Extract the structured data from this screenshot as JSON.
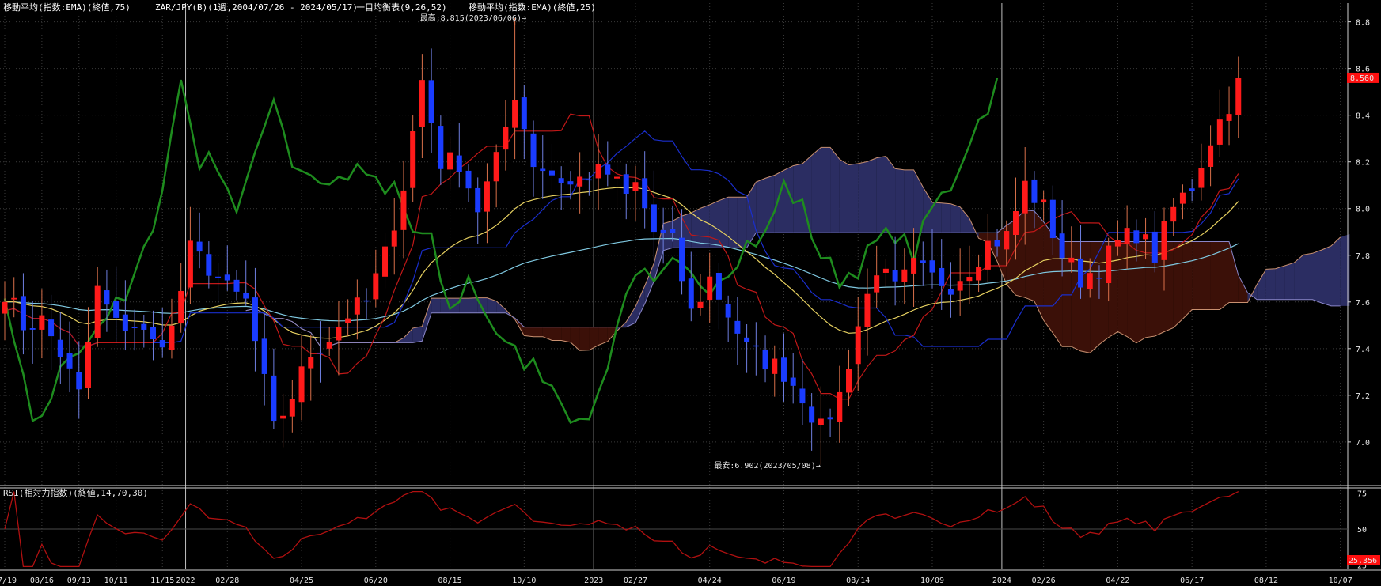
{
  "header": {
    "ma75_label": "移動平均(指数:EMA)(終値,75)",
    "instrument_label": "ZAR/JPY(B)(1週,2004/07/26 - 2024/05/17)",
    "ichimoku_label": "一目均衡表(9,26,52)",
    "ma25_label": "移動平均(指数:EMA)(終値,25)"
  },
  "annotations": {
    "high": "最高:8.815(2023/06/06)→",
    "low": "最安:6.902(2023/05/08)→"
  },
  "last_price": "8.560",
  "rsi_label": "RSI(相対力指数)(終値,14,70,30)",
  "rsi_last": "25.356",
  "colors": {
    "up_candle": "#ff1a1a",
    "down_candle": "#1a3cff",
    "chikou": "#1e8c1e",
    "tenkan": "#c01818",
    "kijun": "#1a2ecc",
    "ema25": "#e6d060",
    "ema75": "#7fc8e0",
    "kumo_bear": "#3b1008",
    "kumo_bull": "#2b2d62",
    "rsi": "#b01010"
  },
  "chart_data": {
    "type": "candlestick",
    "y_ticks": [
      "8.8",
      "8.6",
      "8.4",
      "8.2",
      "8.0",
      "7.8",
      "7.6",
      "7.4",
      "7.2",
      "7.0"
    ],
    "ylim": [
      6.82,
      8.88
    ],
    "rsi_ticks": [
      "75",
      "50",
      "25"
    ],
    "rsi_ylim": [
      22,
      78
    ],
    "x_labels": [
      {
        "t": 0,
        "label": "07/19"
      },
      {
        "t": 4,
        "label": "08/16"
      },
      {
        "t": 8,
        "label": "09/13"
      },
      {
        "t": 12,
        "label": "10/11"
      },
      {
        "t": 17,
        "label": "11/15"
      },
      {
        "t": 24,
        "label": "02/28",
        "year": "2022"
      },
      {
        "t": 32,
        "label": "04/25"
      },
      {
        "t": 40,
        "label": "06/20"
      },
      {
        "t": 48,
        "label": "08/15"
      },
      {
        "t": 56,
        "label": "10/10"
      },
      {
        "t": 68,
        "label": "02/27",
        "year": "2023"
      },
      {
        "t": 76,
        "label": "04/24"
      },
      {
        "t": 84,
        "label": "06/19"
      },
      {
        "t": 92,
        "label": "08/14"
      },
      {
        "t": 100,
        "label": "10/09"
      },
      {
        "t": 112,
        "label": "02/26",
        "year": "2024"
      },
      {
        "t": 120,
        "label": "04/22"
      },
      {
        "t": 128,
        "label": "06/17"
      },
      {
        "t": 136,
        "label": "08/12"
      },
      {
        "t": 144,
        "label": "10/07"
      }
    ],
    "year_dividers": [
      {
        "t": 20,
        "label": "2022"
      },
      {
        "t": 64,
        "label": "2023"
      },
      {
        "t": 108,
        "label": "2024"
      }
    ],
    "close_anchors": [
      [
        0,
        7.65
      ],
      [
        2,
        7.5
      ],
      [
        4,
        7.52
      ],
      [
        6,
        7.38
      ],
      [
        8,
        7.2
      ],
      [
        10,
        7.65
      ],
      [
        12,
        7.5
      ],
      [
        14,
        7.5
      ],
      [
        16,
        7.42
      ],
      [
        18,
        7.48
      ],
      [
        20,
        7.82
      ],
      [
        22,
        7.75
      ],
      [
        24,
        7.65
      ],
      [
        26,
        7.6
      ],
      [
        28,
        7.25
      ],
      [
        29,
        7.05
      ],
      [
        31,
        7.2
      ],
      [
        33,
        7.38
      ],
      [
        35,
        7.45
      ],
      [
        37,
        7.55
      ],
      [
        39,
        7.6
      ],
      [
        41,
        7.8
      ],
      [
        43,
        8.1
      ],
      [
        45,
        8.55
      ],
      [
        47,
        8.2
      ],
      [
        49,
        8.2
      ],
      [
        51,
        8.0
      ],
      [
        53,
        8.2
      ],
      [
        55,
        8.5
      ],
      [
        57,
        8.2
      ],
      [
        59,
        8.15
      ],
      [
        61,
        8.1
      ],
      [
        63,
        8.15
      ],
      [
        65,
        8.15
      ],
      [
        67,
        8.05
      ],
      [
        68,
        8.1
      ],
      [
        70,
        7.9
      ],
      [
        72,
        7.85
      ],
      [
        74,
        7.55
      ],
      [
        76,
        7.7
      ],
      [
        78,
        7.55
      ],
      [
        80,
        7.4
      ],
      [
        82,
        7.35
      ],
      [
        84,
        7.3
      ],
      [
        86,
        7.2
      ],
      [
        88,
        7.05
      ],
      [
        90,
        7.2
      ],
      [
        92,
        7.5
      ],
      [
        94,
        7.75
      ],
      [
        96,
        7.65
      ],
      [
        98,
        7.75
      ],
      [
        100,
        7.7
      ],
      [
        102,
        7.68
      ],
      [
        104,
        7.75
      ],
      [
        106,
        7.85
      ],
      [
        108,
        7.88
      ],
      [
        110,
        8.1
      ],
      [
        112,
        8.0
      ],
      [
        114,
        7.8
      ],
      [
        116,
        7.7
      ],
      [
        118,
        7.75
      ],
      [
        120,
        7.85
      ],
      [
        122,
        7.9
      ],
      [
        124,
        7.8
      ],
      [
        126,
        8.0
      ],
      [
        128,
        8.1
      ],
      [
        130,
        8.3
      ],
      [
        132,
        8.45
      ],
      [
        133,
        8.56
      ]
    ],
    "high_annotation": {
      "t": 55,
      "value": 8.815
    },
    "low_annotation": {
      "t": 88,
      "value": 6.902
    }
  }
}
